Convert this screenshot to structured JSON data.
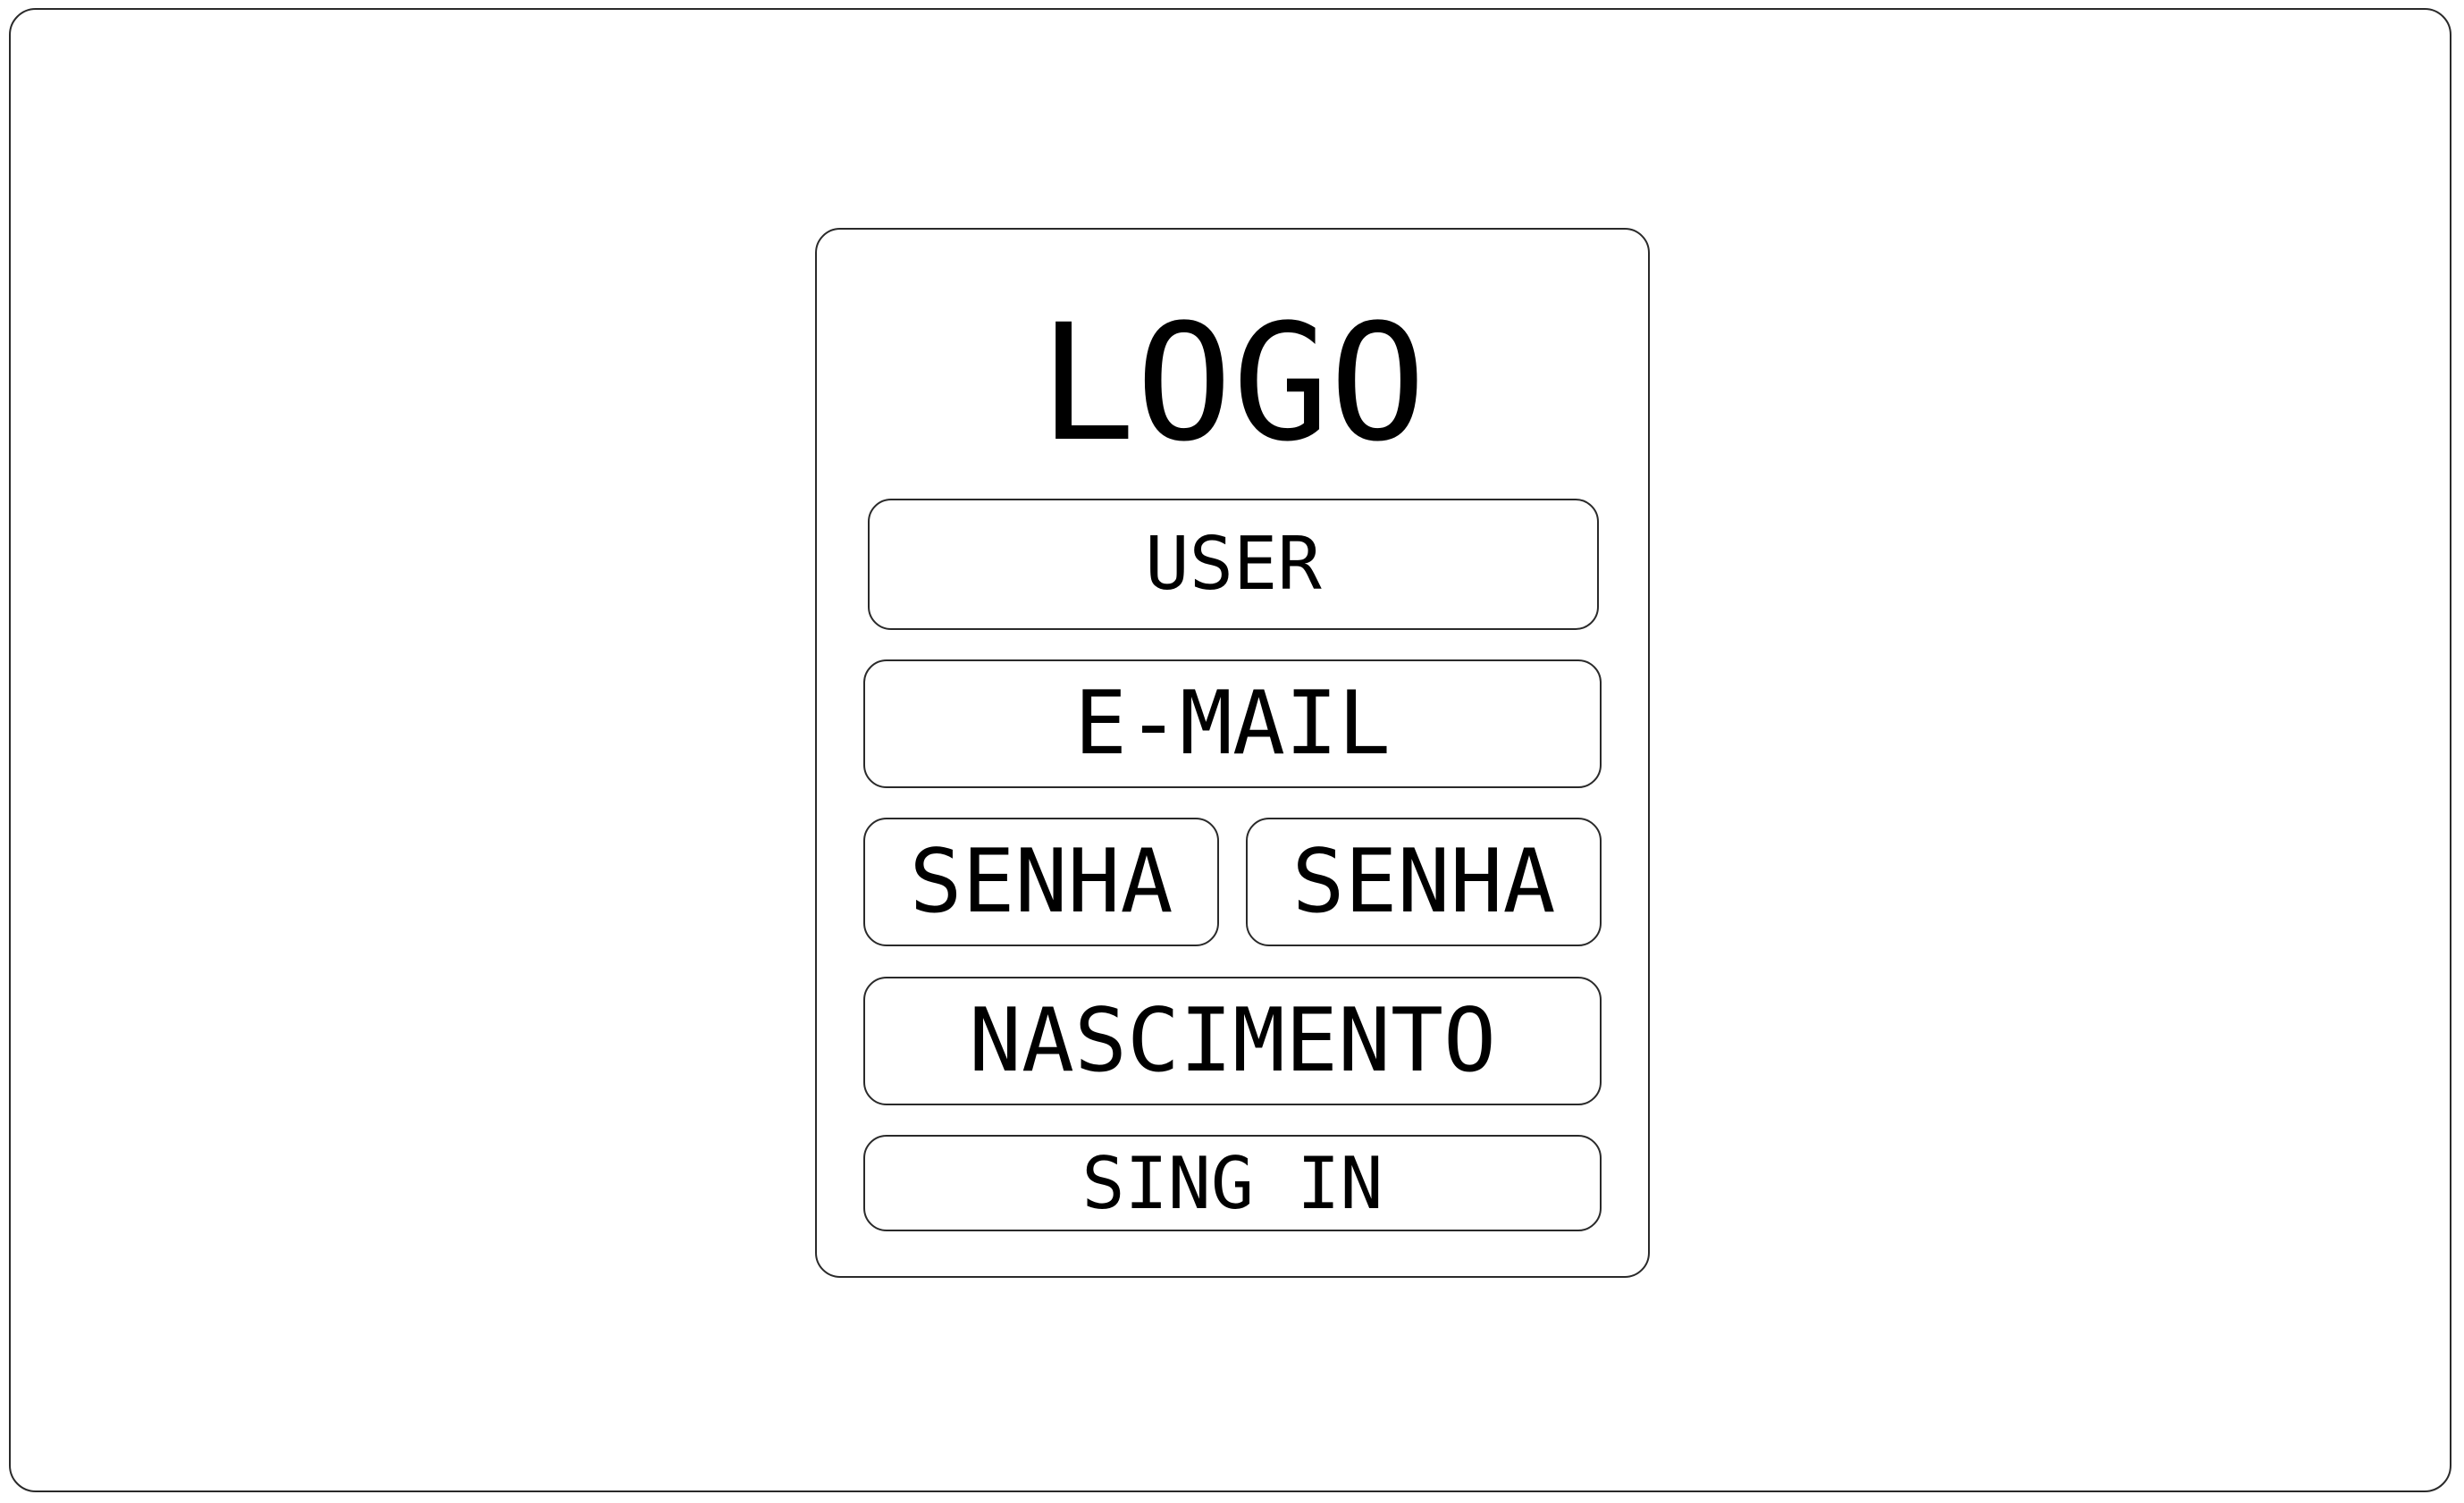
{
  "logo": {
    "text": "LOGO"
  },
  "form": {
    "user_placeholder": "USER",
    "email_placeholder": "E-MAIL",
    "password_placeholder": "SENHA",
    "password_confirm_placeholder": "SENHA",
    "birthdate_placeholder": "NASCIMENTO",
    "signin_label": "SING IN"
  },
  "colors": {
    "border": "#2a2a2a",
    "text": "#000000",
    "background": "#ffffff"
  }
}
